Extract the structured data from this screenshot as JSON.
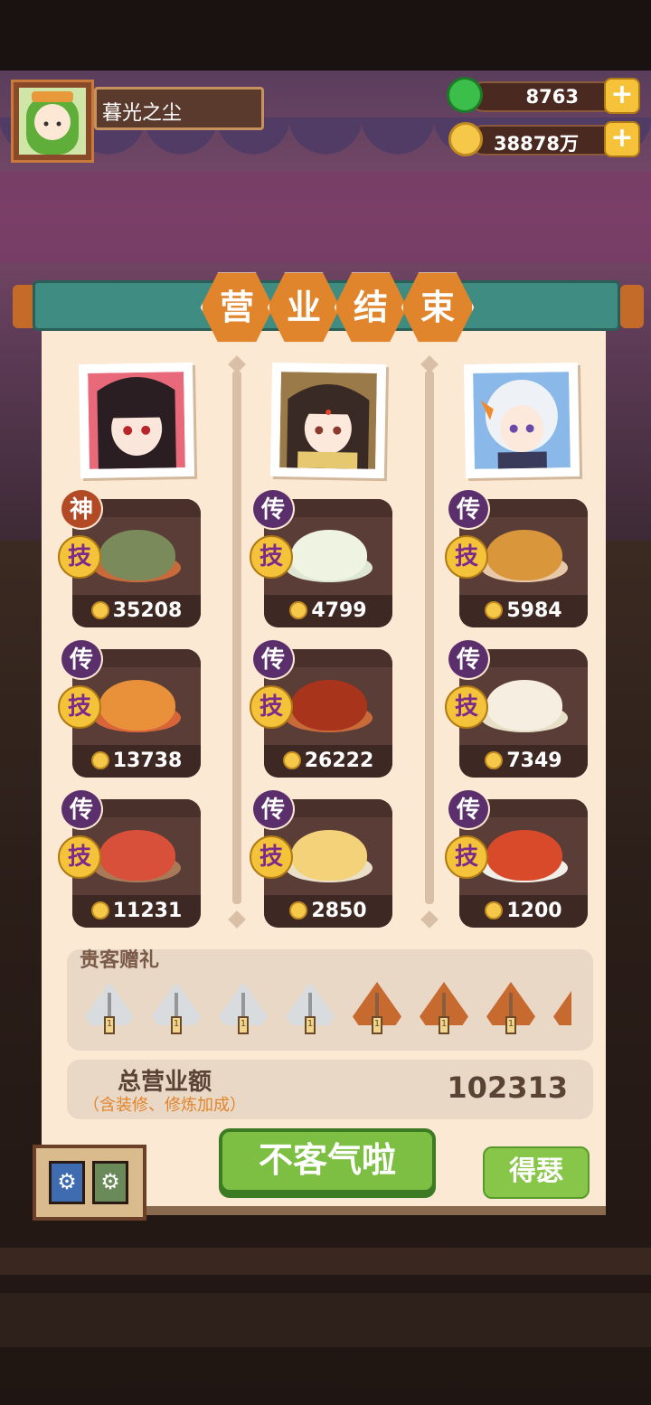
{
  "player": {
    "name": "暮光之尘"
  },
  "currency": {
    "jade": "8763",
    "coins": "38878万",
    "plus_label": "+"
  },
  "panel": {
    "title_chars": [
      "营",
      "业",
      "结",
      "束"
    ]
  },
  "chefs": [
    {
      "dishes": [
        {
          "rank": "神",
          "skill": "技",
          "price": "35208",
          "colors": [
            "#7a8a5a",
            "#c96a3a"
          ]
        },
        {
          "rank": "传",
          "skill": "技",
          "price": "13738",
          "colors": [
            "#e8913a",
            "#d8643a"
          ]
        },
        {
          "rank": "传",
          "skill": "技",
          "price": "11231",
          "colors": [
            "#d8503a",
            "#a87a58"
          ]
        }
      ]
    },
    {
      "dishes": [
        {
          "rank": "传",
          "skill": "技",
          "price": "4799",
          "colors": [
            "#eef3e2",
            "#dfe7d4"
          ]
        },
        {
          "rank": "传",
          "skill": "技",
          "price": "26222",
          "colors": [
            "#a8341c",
            "#c86a3a"
          ]
        },
        {
          "rank": "传",
          "skill": "技",
          "price": "2850",
          "colors": [
            "#f3d27a",
            "#eadfc8"
          ]
        }
      ]
    },
    {
      "dishes": [
        {
          "rank": "传",
          "skill": "技",
          "price": "5984",
          "colors": [
            "#d9963a",
            "#e8c8a8"
          ]
        },
        {
          "rank": "传",
          "skill": "技",
          "price": "7349",
          "colors": [
            "#f6eee0",
            "#e8dfc8"
          ]
        },
        {
          "rank": "传",
          "skill": "技",
          "price": "1200",
          "colors": [
            "#d84a2a",
            "#f0efe8"
          ]
        }
      ]
    }
  ],
  "gifts": {
    "title": "贵客赠礼",
    "count_label": "1",
    "items": [
      "silver",
      "silver",
      "silver",
      "silver",
      "copper",
      "copper",
      "copper",
      "copper"
    ]
  },
  "total": {
    "label": "总营业额",
    "sub": "（含装修、修炼加成）",
    "value": "102313"
  },
  "buttons": {
    "main": "不客气啦",
    "side": "得瑟"
  }
}
